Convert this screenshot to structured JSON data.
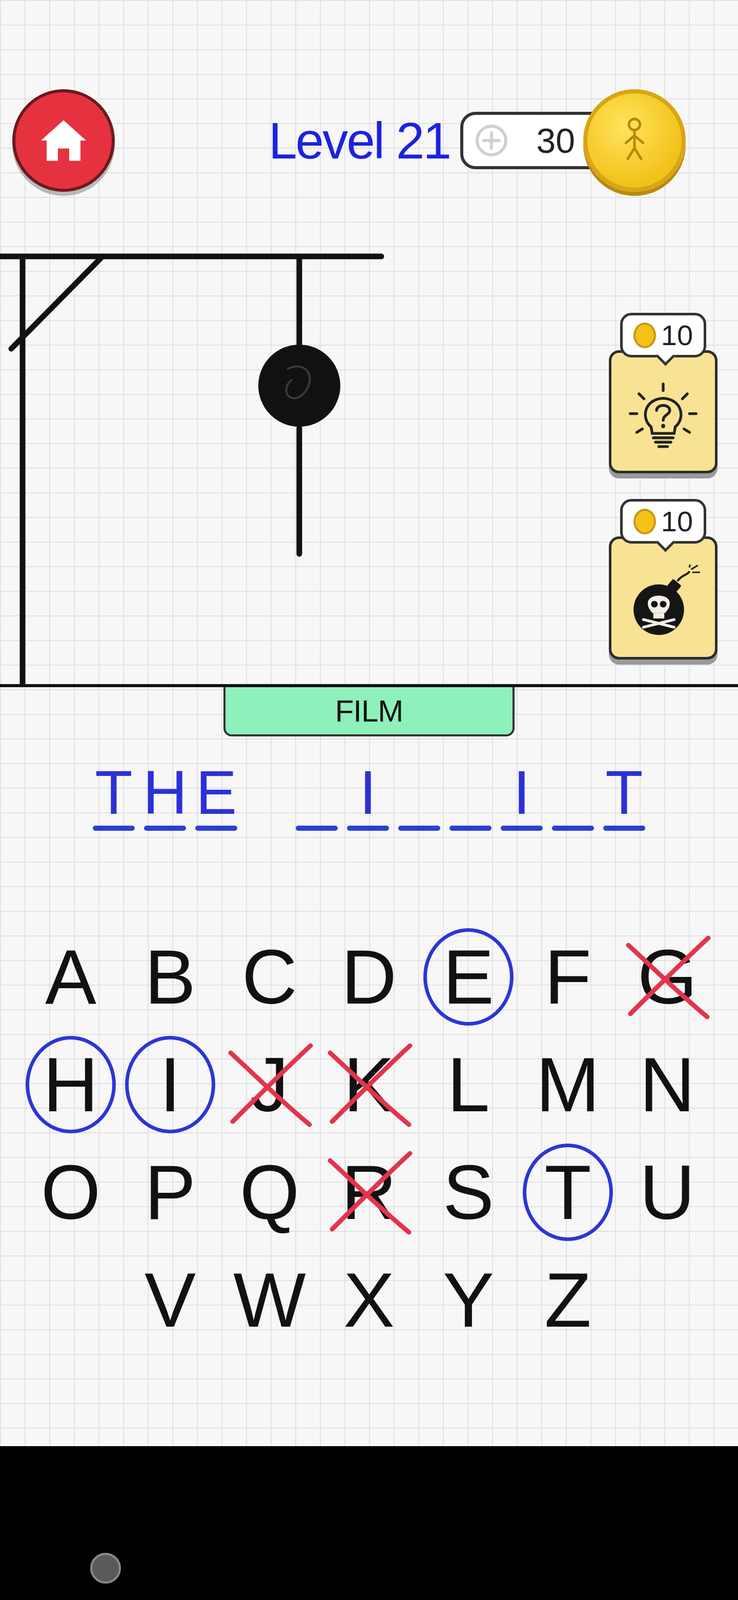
{
  "level": "Level 21",
  "coins": "30",
  "powerups": [
    {
      "kind": "hint",
      "cost": "10"
    },
    {
      "kind": "bomb",
      "cost": "10"
    }
  ],
  "hangman": {
    "head": true,
    "body": true,
    "left_arm": false,
    "right_arm": false,
    "left_leg": false,
    "right_leg": false
  },
  "category": "FILM",
  "words": [
    {
      "slots": [
        "T",
        "H",
        "E"
      ]
    },
    {
      "slots": [
        "",
        "I",
        "",
        "",
        "I",
        "",
        "T"
      ]
    }
  ],
  "keyboard": [
    [
      {
        "letter": "A",
        "state": "unused"
      },
      {
        "letter": "B",
        "state": "unused"
      },
      {
        "letter": "C",
        "state": "unused"
      },
      {
        "letter": "D",
        "state": "unused"
      },
      {
        "letter": "E",
        "state": "correct"
      },
      {
        "letter": "F",
        "state": "unused"
      },
      {
        "letter": "G",
        "state": "wrong"
      }
    ],
    [
      {
        "letter": "H",
        "state": "correct"
      },
      {
        "letter": "I",
        "state": "correct"
      },
      {
        "letter": "J",
        "state": "wrong"
      },
      {
        "letter": "K",
        "state": "wrong"
      },
      {
        "letter": "L",
        "state": "unused"
      },
      {
        "letter": "M",
        "state": "unused"
      },
      {
        "letter": "N",
        "state": "unused"
      }
    ],
    [
      {
        "letter": "O",
        "state": "unused"
      },
      {
        "letter": "P",
        "state": "unused"
      },
      {
        "letter": "Q",
        "state": "unused"
      },
      {
        "letter": "R",
        "state": "wrong"
      },
      {
        "letter": "S",
        "state": "unused"
      },
      {
        "letter": "T",
        "state": "correct"
      },
      {
        "letter": "U",
        "state": "unused"
      }
    ],
    [
      {
        "letter": "V",
        "state": "unused"
      },
      {
        "letter": "W",
        "state": "unused"
      },
      {
        "letter": "X",
        "state": "unused"
      },
      {
        "letter": "Y",
        "state": "unused"
      },
      {
        "letter": "Z",
        "state": "unused"
      }
    ]
  ]
}
